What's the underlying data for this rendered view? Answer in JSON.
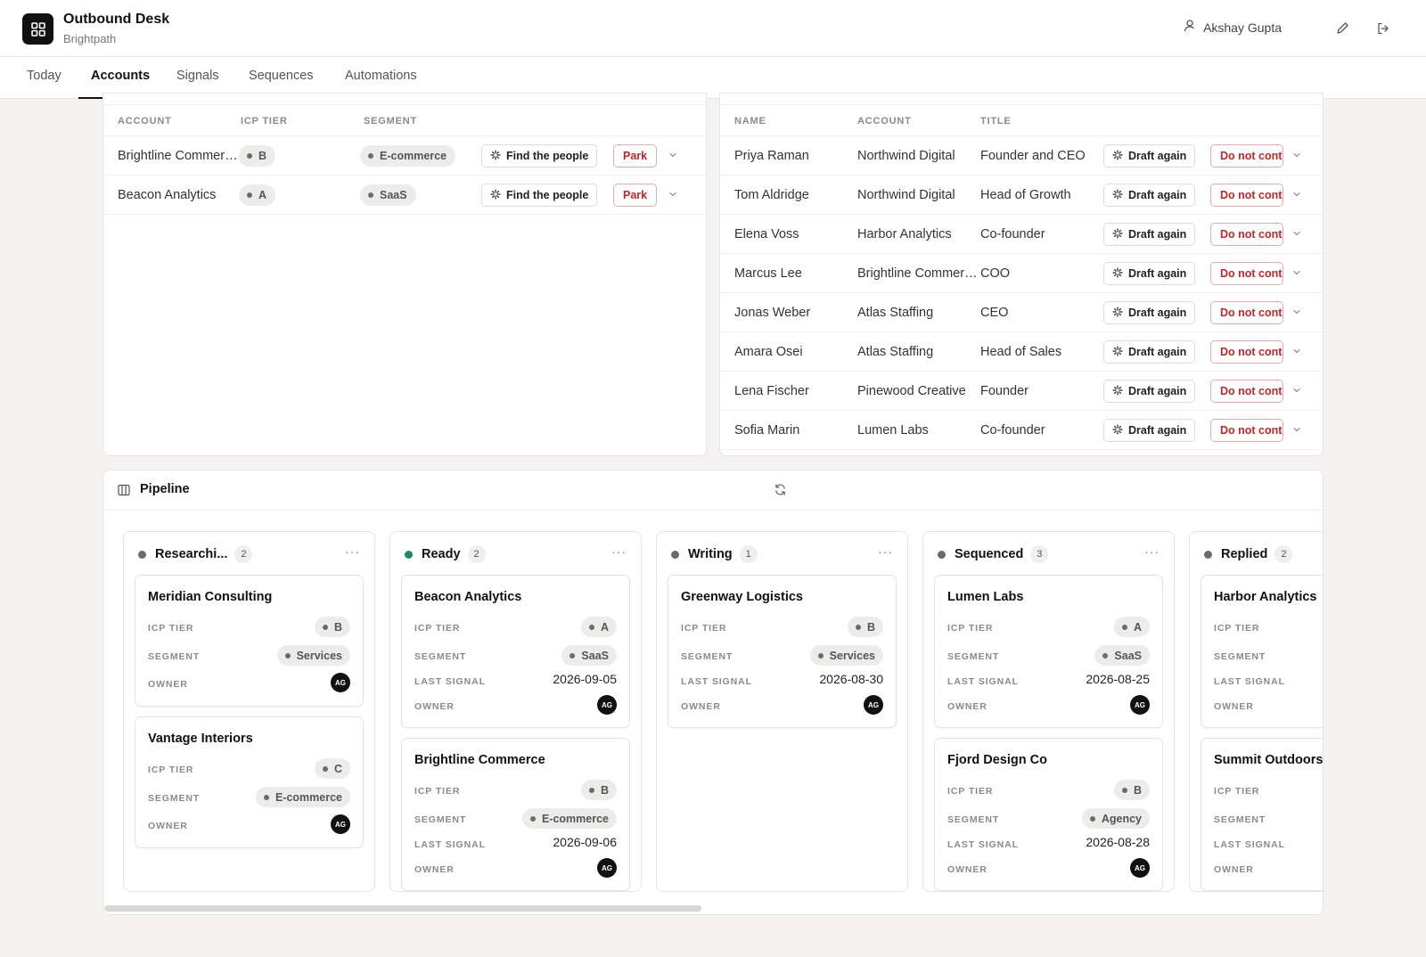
{
  "app": {
    "title": "Outbound Desk",
    "subtitle": "Brightpath",
    "user_name": "Akshay Gupta",
    "logo_icon": "grid-icon",
    "edit_icon": "pencil-icon",
    "logout_icon": "logout-icon",
    "colors": {
      "accent": "#111111",
      "danger": "#c0272d",
      "ready_dot": "#1f8a5b"
    }
  },
  "tabs": [
    "Today",
    "Accounts",
    "Signals",
    "Sequences",
    "Automations"
  ],
  "active_tab": "Accounts",
  "accounts_table": {
    "headers": [
      "ACCOUNT",
      "ICP TIER",
      "SEGMENT"
    ],
    "rows": [
      {
        "account": "Brightline Commerce",
        "tier": "B",
        "segment": "E-commerce",
        "action": "Find the people",
        "park": "Park"
      },
      {
        "account": "Beacon Analytics",
        "tier": "A",
        "segment": "SaaS",
        "action": "Find the people",
        "park": "Park"
      }
    ]
  },
  "people_table": {
    "headers": [
      "NAME",
      "ACCOUNT",
      "TITLE"
    ],
    "draft_label": "Draft again",
    "dnc_label": "Do not contact",
    "rows": [
      {
        "name": "Priya Raman",
        "account": "Northwind Digital",
        "title": "Founder and CEO"
      },
      {
        "name": "Tom Aldridge",
        "account": "Northwind Digital",
        "title": "Head of Growth"
      },
      {
        "name": "Elena Voss",
        "account": "Harbor Analytics",
        "title": "Co-founder"
      },
      {
        "name": "Marcus Lee",
        "account": "Brightline Commerce",
        "title": "COO"
      },
      {
        "name": "Jonas Weber",
        "account": "Atlas Staffing",
        "title": "CEO"
      },
      {
        "name": "Amara Osei",
        "account": "Atlas Staffing",
        "title": "Head of Sales"
      },
      {
        "name": "Lena Fischer",
        "account": "Pinewood Creative",
        "title": "Founder"
      },
      {
        "name": "Sofia Marin",
        "account": "Lumen Labs",
        "title": "Co-founder"
      }
    ]
  },
  "pipeline": {
    "title": "Pipeline",
    "labels": {
      "tier": "ICP TIER",
      "segment": "SEGMENT",
      "signal": "LAST SIGNAL",
      "owner": "OWNER"
    },
    "owner_initials": "AG",
    "columns": [
      {
        "title": "Researchi...",
        "count": "2",
        "dot": "#6b6b6b",
        "cards": [
          {
            "name": "Meridian Consulting",
            "tier": "B",
            "segment": "Services",
            "last_signal": ""
          },
          {
            "name": "Vantage Interiors",
            "tier": "C",
            "segment": "E-commerce",
            "last_signal": ""
          }
        ]
      },
      {
        "title": "Ready",
        "count": "2",
        "dot": "#1f8a5b",
        "cards": [
          {
            "name": "Beacon Analytics",
            "tier": "A",
            "segment": "SaaS",
            "last_signal": "2026-09-05"
          },
          {
            "name": "Brightline Commerce",
            "tier": "B",
            "segment": "E-commerce",
            "last_signal": "2026-09-06"
          }
        ]
      },
      {
        "title": "Writing",
        "count": "1",
        "dot": "#6b6b6b",
        "cards": [
          {
            "name": "Greenway Logistics",
            "tier": "B",
            "segment": "Services",
            "last_signal": "2026-08-30"
          }
        ]
      },
      {
        "title": "Sequenced",
        "count": "3",
        "dot": "#6b6b6b",
        "cards": [
          {
            "name": "Lumen Labs",
            "tier": "A",
            "segment": "SaaS",
            "last_signal": "2026-08-25"
          },
          {
            "name": "Fjord Design Co",
            "tier": "B",
            "segment": "Agency",
            "last_signal": "2026-08-28"
          }
        ]
      },
      {
        "title": "Replied",
        "count": "2",
        "dot": "#6b6b6b",
        "cards": [
          {
            "name": "Harbor Analytics",
            "tier": "",
            "segment": "",
            "last_signal": ""
          },
          {
            "name": "Summit Outdoors",
            "tier": "",
            "segment": "",
            "last_signal": ""
          }
        ]
      }
    ]
  }
}
